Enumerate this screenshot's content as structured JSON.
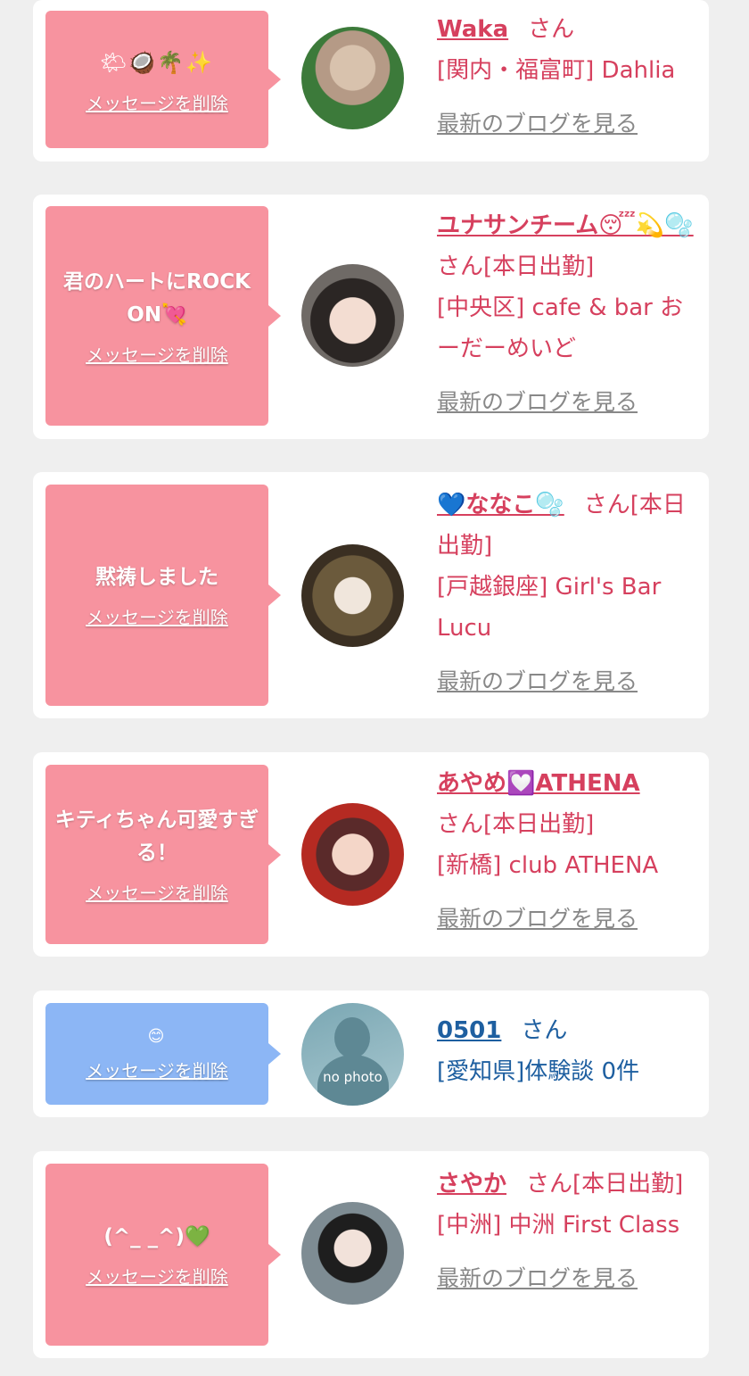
{
  "delete_label": "メッセージを削除",
  "blog_label": "最新のブログを見る",
  "colors": {
    "pink_bubble": "#f7939f",
    "blue_bubble": "#8cb6f5",
    "name_pink": "#d6405e",
    "name_blue": "#1e5fa0"
  },
  "cards": [
    {
      "message": "🌤🥥🌴✨",
      "name": "Waka",
      "san": "さん",
      "store": "[関内・福富町] Dahlia",
      "avatar_icon": "girl-photo"
    },
    {
      "message": "君のハートにROCK ON💘",
      "name": "ユナサンチーム😴💫🫧",
      "san": "さん[本日出勤]",
      "store": "[中央区] cafe & bar おーだーめいど",
      "avatar_icon": "girl-photo"
    },
    {
      "message": "黙祷しました",
      "name": "💙ななこ🫧",
      "san": "さん[本日出勤]",
      "store": "[戸越銀座] Girl's Bar Lucu",
      "avatar_icon": "girl-photo"
    },
    {
      "message": "キティちゃん可愛すぎる！",
      "name": "あやめ💟ATHENA",
      "san": "さん[本日出勤]",
      "store": "[新橋] club ATHENA",
      "avatar_icon": "girl-photo"
    },
    {
      "message": "😊",
      "name": "0501",
      "san": "さん",
      "store": "[愛知県]体験談 0件",
      "avatar_icon": "no-photo",
      "avatar_text": "no photo"
    },
    {
      "message": "(^_ _^)💚",
      "name": "さやか",
      "san": "さん[本日出勤]",
      "store": "[中洲] 中洲 First Class",
      "avatar_icon": "girl-photo"
    }
  ]
}
